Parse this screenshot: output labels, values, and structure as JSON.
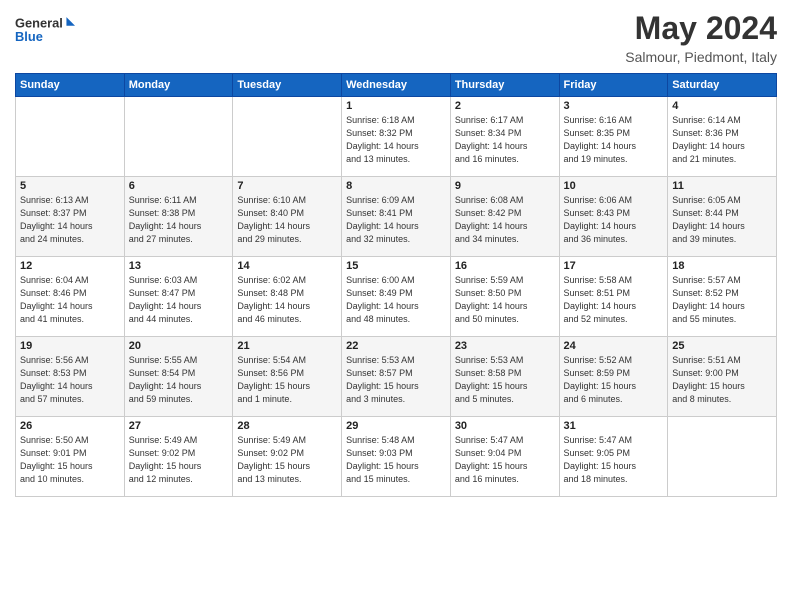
{
  "header": {
    "logo_line1": "General",
    "logo_line2": "Blue",
    "month_year": "May 2024",
    "location": "Salmour, Piedmont, Italy"
  },
  "weekdays": [
    "Sunday",
    "Monday",
    "Tuesday",
    "Wednesday",
    "Thursday",
    "Friday",
    "Saturday"
  ],
  "weeks": [
    [
      {
        "day": "",
        "info": ""
      },
      {
        "day": "",
        "info": ""
      },
      {
        "day": "",
        "info": ""
      },
      {
        "day": "1",
        "info": "Sunrise: 6:18 AM\nSunset: 8:32 PM\nDaylight: 14 hours\nand 13 minutes."
      },
      {
        "day": "2",
        "info": "Sunrise: 6:17 AM\nSunset: 8:34 PM\nDaylight: 14 hours\nand 16 minutes."
      },
      {
        "day": "3",
        "info": "Sunrise: 6:16 AM\nSunset: 8:35 PM\nDaylight: 14 hours\nand 19 minutes."
      },
      {
        "day": "4",
        "info": "Sunrise: 6:14 AM\nSunset: 8:36 PM\nDaylight: 14 hours\nand 21 minutes."
      }
    ],
    [
      {
        "day": "5",
        "info": "Sunrise: 6:13 AM\nSunset: 8:37 PM\nDaylight: 14 hours\nand 24 minutes."
      },
      {
        "day": "6",
        "info": "Sunrise: 6:11 AM\nSunset: 8:38 PM\nDaylight: 14 hours\nand 27 minutes."
      },
      {
        "day": "7",
        "info": "Sunrise: 6:10 AM\nSunset: 8:40 PM\nDaylight: 14 hours\nand 29 minutes."
      },
      {
        "day": "8",
        "info": "Sunrise: 6:09 AM\nSunset: 8:41 PM\nDaylight: 14 hours\nand 32 minutes."
      },
      {
        "day": "9",
        "info": "Sunrise: 6:08 AM\nSunset: 8:42 PM\nDaylight: 14 hours\nand 34 minutes."
      },
      {
        "day": "10",
        "info": "Sunrise: 6:06 AM\nSunset: 8:43 PM\nDaylight: 14 hours\nand 36 minutes."
      },
      {
        "day": "11",
        "info": "Sunrise: 6:05 AM\nSunset: 8:44 PM\nDaylight: 14 hours\nand 39 minutes."
      }
    ],
    [
      {
        "day": "12",
        "info": "Sunrise: 6:04 AM\nSunset: 8:46 PM\nDaylight: 14 hours\nand 41 minutes."
      },
      {
        "day": "13",
        "info": "Sunrise: 6:03 AM\nSunset: 8:47 PM\nDaylight: 14 hours\nand 44 minutes."
      },
      {
        "day": "14",
        "info": "Sunrise: 6:02 AM\nSunset: 8:48 PM\nDaylight: 14 hours\nand 46 minutes."
      },
      {
        "day": "15",
        "info": "Sunrise: 6:00 AM\nSunset: 8:49 PM\nDaylight: 14 hours\nand 48 minutes."
      },
      {
        "day": "16",
        "info": "Sunrise: 5:59 AM\nSunset: 8:50 PM\nDaylight: 14 hours\nand 50 minutes."
      },
      {
        "day": "17",
        "info": "Sunrise: 5:58 AM\nSunset: 8:51 PM\nDaylight: 14 hours\nand 52 minutes."
      },
      {
        "day": "18",
        "info": "Sunrise: 5:57 AM\nSunset: 8:52 PM\nDaylight: 14 hours\nand 55 minutes."
      }
    ],
    [
      {
        "day": "19",
        "info": "Sunrise: 5:56 AM\nSunset: 8:53 PM\nDaylight: 14 hours\nand 57 minutes."
      },
      {
        "day": "20",
        "info": "Sunrise: 5:55 AM\nSunset: 8:54 PM\nDaylight: 14 hours\nand 59 minutes."
      },
      {
        "day": "21",
        "info": "Sunrise: 5:54 AM\nSunset: 8:56 PM\nDaylight: 15 hours\nand 1 minute."
      },
      {
        "day": "22",
        "info": "Sunrise: 5:53 AM\nSunset: 8:57 PM\nDaylight: 15 hours\nand 3 minutes."
      },
      {
        "day": "23",
        "info": "Sunrise: 5:53 AM\nSunset: 8:58 PM\nDaylight: 15 hours\nand 5 minutes."
      },
      {
        "day": "24",
        "info": "Sunrise: 5:52 AM\nSunset: 8:59 PM\nDaylight: 15 hours\nand 6 minutes."
      },
      {
        "day": "25",
        "info": "Sunrise: 5:51 AM\nSunset: 9:00 PM\nDaylight: 15 hours\nand 8 minutes."
      }
    ],
    [
      {
        "day": "26",
        "info": "Sunrise: 5:50 AM\nSunset: 9:01 PM\nDaylight: 15 hours\nand 10 minutes."
      },
      {
        "day": "27",
        "info": "Sunrise: 5:49 AM\nSunset: 9:02 PM\nDaylight: 15 hours\nand 12 minutes."
      },
      {
        "day": "28",
        "info": "Sunrise: 5:49 AM\nSunset: 9:02 PM\nDaylight: 15 hours\nand 13 minutes."
      },
      {
        "day": "29",
        "info": "Sunrise: 5:48 AM\nSunset: 9:03 PM\nDaylight: 15 hours\nand 15 minutes."
      },
      {
        "day": "30",
        "info": "Sunrise: 5:47 AM\nSunset: 9:04 PM\nDaylight: 15 hours\nand 16 minutes."
      },
      {
        "day": "31",
        "info": "Sunrise: 5:47 AM\nSunset: 9:05 PM\nDaylight: 15 hours\nand 18 minutes."
      },
      {
        "day": "",
        "info": ""
      }
    ]
  ]
}
